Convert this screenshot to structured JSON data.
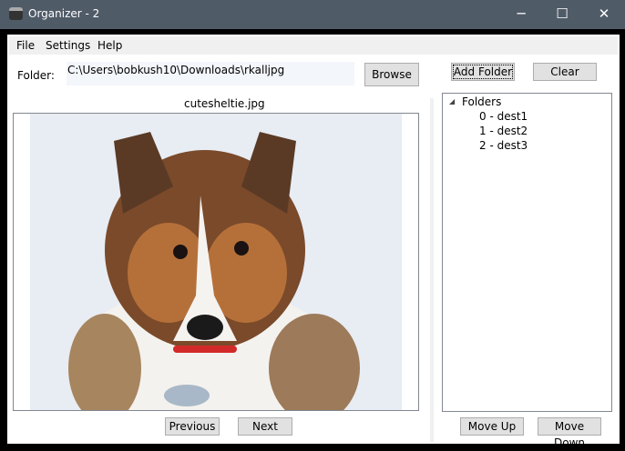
{
  "window": {
    "title": "Organizer - 2",
    "minimize": "─",
    "maximize": "☐",
    "close": "✕"
  },
  "menu": [
    "File",
    "Settings",
    "Help"
  ],
  "folder": {
    "label": "Folder:",
    "path": "C:\\Users\\bobkush10\\Downloads\\rkalljpg",
    "browse": "Browse"
  },
  "image": {
    "filename": "cutesheltie.jpg"
  },
  "nav": {
    "previous": "Previous",
    "next": "Next"
  },
  "right": {
    "add_folder": "Add Folder",
    "clear": "Clear",
    "move_up": "Move Up",
    "move_down": "Move Down"
  },
  "tree": {
    "root": "Folders",
    "expander": "◢",
    "items": [
      "0 - dest1",
      "1 - dest2",
      "2 - dest3"
    ]
  }
}
